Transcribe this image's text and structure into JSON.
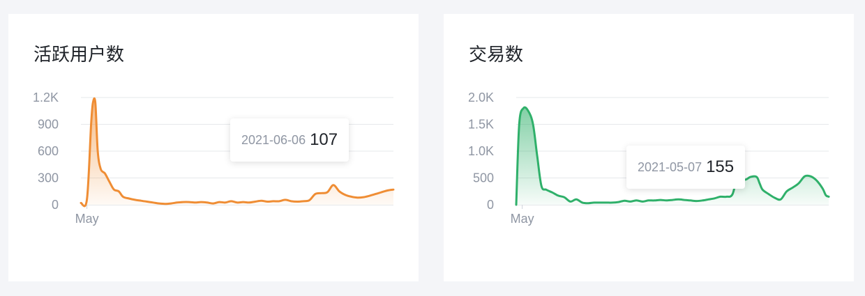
{
  "cards": [
    {
      "title": "活跃用户数",
      "tooltip": {
        "date": "2021-06-06",
        "value": "107"
      },
      "color": "#ef8d34"
    },
    {
      "title": "交易数",
      "tooltip": {
        "date": "2021-05-07",
        "value": "155"
      },
      "color": "#2fb06a"
    }
  ],
  "chart_data": [
    {
      "type": "area",
      "title": "活跃用户数",
      "ylim": [
        0,
        1200
      ],
      "yticks": [
        0,
        300,
        600,
        900,
        1200
      ],
      "ytick_labels": [
        "0",
        "300",
        "600",
        "900",
        "1.2K"
      ],
      "xlim": [
        0,
        52
      ],
      "xticks": [
        {
          "x": 1,
          "label": "May"
        }
      ],
      "grid": true,
      "color": "#ef8d34",
      "series": [
        {
          "x": [
            0,
            1,
            1.7,
            2,
            2.4,
            2.8,
            3.3,
            4,
            4.8,
            5.5,
            6.3,
            7,
            8,
            9,
            10,
            11,
            12,
            13,
            14,
            15,
            16,
            17,
            18,
            19,
            20,
            21,
            22,
            23,
            24,
            25,
            26,
            27,
            28,
            29,
            30,
            31,
            32,
            33,
            34,
            35,
            36,
            37,
            38,
            39,
            40,
            41,
            42,
            43,
            44,
            45,
            46,
            47,
            48,
            49,
            50,
            51,
            52
          ],
          "y": [
            20,
            60,
            900,
            1140,
            1140,
            600,
            400,
            350,
            250,
            170,
            150,
            90,
            70,
            55,
            45,
            35,
            25,
            15,
            10,
            15,
            25,
            30,
            30,
            25,
            30,
            25,
            15,
            30,
            25,
            40,
            25,
            30,
            25,
            35,
            45,
            35,
            40,
            40,
            55,
            40,
            35,
            40,
            50,
            120,
            130,
            140,
            220,
            150,
            110,
            90,
            80,
            85,
            100,
            120,
            140,
            160,
            170
          ]
        }
      ]
    },
    {
      "type": "area",
      "title": "交易数",
      "ylim": [
        0,
        2000
      ],
      "yticks": [
        0,
        500,
        1000,
        1500,
        2000
      ],
      "ytick_labels": [
        "0",
        "500",
        "1.0K",
        "1.5K",
        "2.0K"
      ],
      "xlim": [
        0,
        52
      ],
      "xticks": [
        {
          "x": 1,
          "label": "May"
        }
      ],
      "grid": true,
      "color": "#2fb06a",
      "series": [
        {
          "x": [
            0,
            0.5,
            1.2,
            2,
            2.8,
            3.5,
            4.2,
            5,
            6,
            7,
            8,
            9,
            10,
            11,
            12,
            13,
            14,
            15,
            16,
            17,
            18,
            19,
            20,
            21,
            22,
            23,
            24,
            25,
            26,
            27,
            28,
            29,
            30,
            31,
            32,
            33,
            34,
            35,
            36,
            37,
            38,
            39,
            40,
            40.5,
            41,
            42,
            43,
            44,
            45,
            46,
            47,
            48,
            49,
            50,
            51,
            51.5,
            52
          ],
          "y": [
            0,
            1500,
            1800,
            1750,
            1500,
            900,
            350,
            280,
            230,
            170,
            140,
            60,
            100,
            40,
            30,
            40,
            40,
            40,
            40,
            50,
            75,
            60,
            80,
            60,
            80,
            80,
            90,
            80,
            90,
            100,
            90,
            80,
            70,
            80,
            100,
            120,
            150,
            150,
            200,
            600,
            470,
            520,
            520,
            400,
            280,
            200,
            130,
            100,
            250,
            320,
            400,
            530,
            530,
            450,
            300,
            180,
            150
          ]
        }
      ]
    }
  ]
}
